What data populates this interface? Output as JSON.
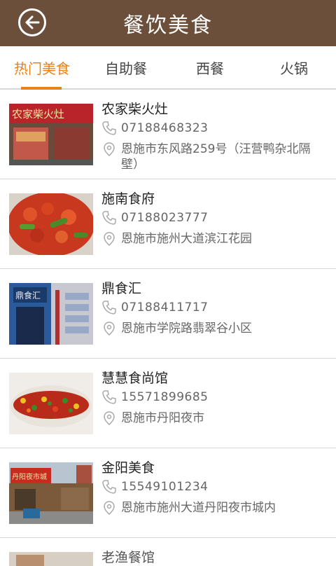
{
  "header": {
    "title": "餐饮美食"
  },
  "tabs": [
    {
      "label": "热门美食"
    },
    {
      "label": "自助餐"
    },
    {
      "label": "西餐"
    },
    {
      "label": "火锅"
    }
  ],
  "items": [
    {
      "name": "农家柴火灶",
      "phone": "07188468323",
      "address": "恩施市东风路259号（汪营鸭杂北隔壁）",
      "image_sign": "农家柴火灶"
    },
    {
      "name": "施南食府",
      "phone": "07188023777",
      "address": "恩施市施州大道滨江花园"
    },
    {
      "name": "鼎食汇",
      "phone": "07188411717",
      "address": "恩施市学院路翡翠谷小区",
      "image_sign": "鼎食汇"
    },
    {
      "name": "慧慧食尚馆",
      "phone": "15571899685",
      "address": "恩施市丹阳夜市"
    },
    {
      "name": "金阳美食",
      "phone": "15549101234",
      "address": "恩施市施州大道丹阳夜市城内",
      "image_sign": "丹阳夜市城"
    },
    {
      "name": "老渔餐馆"
    }
  ]
}
